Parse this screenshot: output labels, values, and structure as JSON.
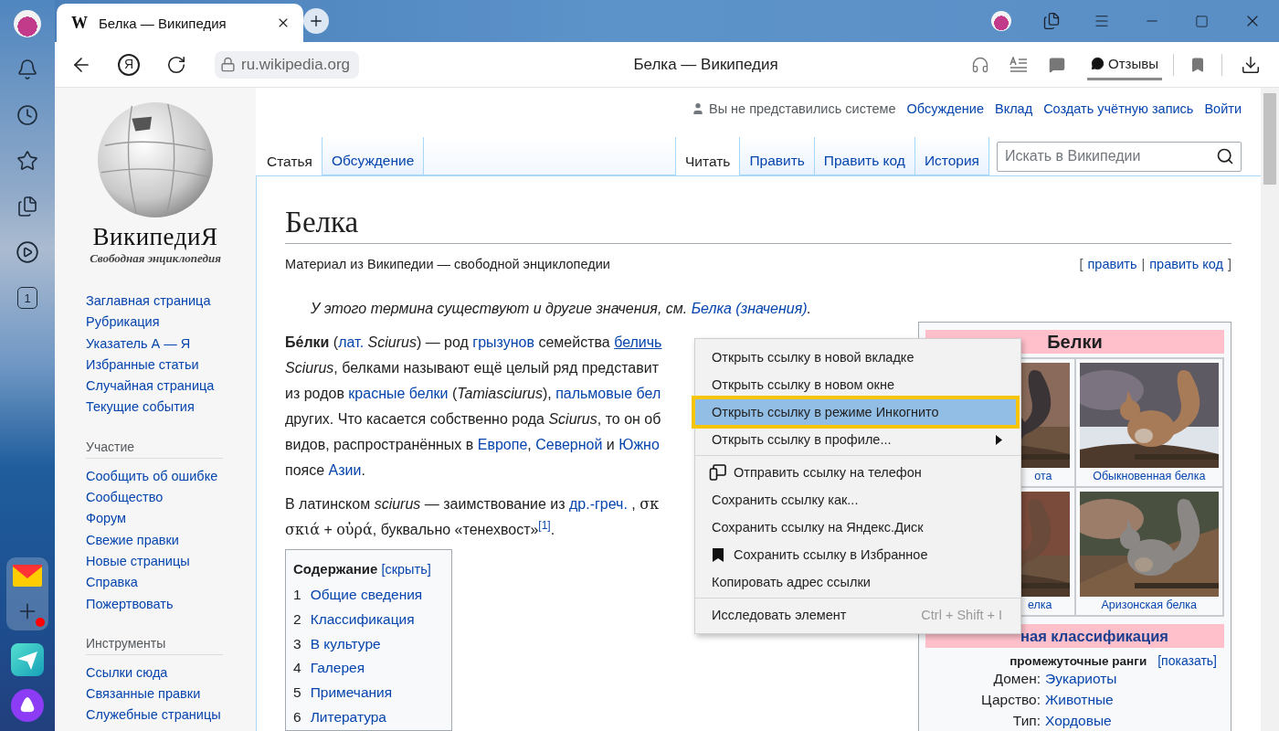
{
  "browser": {
    "tabs": [
      {
        "favicon": "W",
        "title": "Белка — Википедия",
        "selected": true
      }
    ],
    "toolbar": {
      "home_button": "Я",
      "address": "ru.wikipedia.org",
      "page_title": "Белка — Википедия",
      "reviews": "Отзывы"
    },
    "side_rail": {
      "tab_counter": "1"
    }
  },
  "wiki": {
    "logo": {
      "wordmark": "ВикипедиЯ",
      "tagline": "Свободная энциклопедия"
    },
    "nav_groups": [
      {
        "items": [
          "Заглавная страница",
          "Рубрикация",
          "Указатель А — Я",
          "Избранные статьи",
          "Случайная страница",
          "Текущие события"
        ]
      },
      {
        "heading": "Участие",
        "items": [
          "Сообщить об ошибке",
          "Сообщество",
          "Форум",
          "Свежие правки",
          "Новые страницы",
          "Справка",
          "Пожертвовать"
        ]
      },
      {
        "heading": "Инструменты",
        "items": [
          "Ссылки сюда",
          "Связанные правки",
          "Служебные страницы"
        ]
      }
    ],
    "personal": {
      "user": "Вы не представились системе",
      "links": [
        "Обсуждение",
        "Вклад",
        "Создать учётную запись",
        "Войти"
      ]
    },
    "left_tabs": [
      {
        "label": "Статья",
        "selected": true
      },
      {
        "label": "Обсуждение",
        "selected": false
      }
    ],
    "right_tabs": [
      {
        "label": "Читать",
        "selected": true
      },
      {
        "label": "Править",
        "selected": false
      },
      {
        "label": "Править код",
        "selected": false
      },
      {
        "label": "История",
        "selected": false
      }
    ],
    "search": {
      "placeholder": "Искать в Википедии"
    }
  },
  "article": {
    "title": "Белка",
    "subtitle": "Материал из Википедии — свободной энциклопедии",
    "edit_links": {
      "open": "[",
      "separator": "|",
      "close": "]",
      "links": [
        "править",
        "править код"
      ]
    },
    "hatnote": [
      {
        "text": "У этого термина существуют и другие значения, см. "
      },
      {
        "text": "Белка (значения)",
        "link": true
      },
      {
        "text": "."
      }
    ],
    "paragraphs": [
      {
        "lines": [
          [
            {
              "text": "**Бе́лки** ("
            },
            {
              "text": "лат.",
              "link": true
            },
            {
              "text": " *Sciurus*) — род "
            },
            {
              "text": "грызунов",
              "link": true
            },
            {
              "text": " семейства "
            },
            {
              "text": "беличь",
              "link": true,
              "hovered": true
            }
          ],
          [
            {
              "text": "*Sciurus*, белками называют ещё целый ряд представит"
            }
          ],
          [
            {
              "text": "из родов "
            },
            {
              "text": "красные белки",
              "link": true
            },
            {
              "text": " (*Tamiasciurus*), "
            },
            {
              "text": "пальмовые бел",
              "link": true
            }
          ],
          [
            {
              "text": "других. Что касается собственно рода *Sciurus*, то он об"
            }
          ],
          [
            {
              "text": "видов, распространённых в "
            },
            {
              "text": "Европе",
              "link": true
            },
            {
              "text": ", "
            },
            {
              "text": "Северной",
              "link": true
            },
            {
              "text": " и "
            },
            {
              "text": "Южно",
              "link": true
            }
          ],
          [
            {
              "text": "поясе "
            },
            {
              "text": "Азии",
              "link": true
            },
            {
              "text": "."
            }
          ]
        ]
      },
      {
        "lines": [
          [
            {
              "text": "В латинском *sciurus* — заимствование из "
            },
            {
              "text": "др.-греч.",
              "link": true
            },
            {
              "text": " , "
            },
            {
              "text": "σκ",
              "serif": true
            }
          ],
          [
            {
              "text": "σκιά",
              "serif": true
            },
            {
              "text": " + "
            },
            {
              "text": "οὐρά",
              "serif": true
            },
            {
              "text": ", буквально «тенехвост»"
            },
            {
              "text": "[1]",
              "link": true,
              "sup": true
            },
            {
              "text": "."
            }
          ]
        ]
      }
    ],
    "toc": {
      "title": "Содержание",
      "toggle": "[скрыть]",
      "items": [
        {
          "number": "1",
          "text": "Общие сведения"
        },
        {
          "number": "2",
          "text": "Классификация"
        },
        {
          "number": "3",
          "text": "В культуре"
        },
        {
          "number": "4",
          "text": "Галерея"
        },
        {
          "number": "5",
          "text": "Примечания"
        },
        {
          "number": "6",
          "text": "Литература"
        }
      ]
    },
    "infobox": {
      "title": "Белки",
      "images": [
        {
          "caption": "ота"
        },
        {
          "caption": "Обыкновенная белка"
        },
        {
          "caption": "елка"
        },
        {
          "caption": "Аризонская белка"
        }
      ],
      "section": "ная классификация",
      "ranks_label": "промежуточные ранги",
      "ranks_toggle": "[показать]",
      "rows": [
        {
          "label": "Домен:",
          "value": "Эукариоты"
        },
        {
          "label": "Царство:",
          "value": "Животные"
        },
        {
          "label": "Тип:",
          "value": "Хордовые"
        }
      ]
    }
  },
  "context_menu": {
    "groups": [
      [
        {
          "label": "Открыть ссылку в новой вкладке",
          "kind": "plain",
          "selected": false
        },
        {
          "label": "Открыть ссылку в новом окне",
          "kind": "plain",
          "selected": false
        },
        {
          "label": "Открыть ссылку в режиме Инкогнито",
          "kind": "plain",
          "selected": true
        },
        {
          "label": "Открыть ссылку в профиле...",
          "kind": "submenu",
          "selected": false
        }
      ],
      [
        {
          "label": "Отправить ссылку на телефон",
          "kind": "phone",
          "selected": false
        },
        {
          "label": "Сохранить ссылку как...",
          "kind": "plain",
          "selected": false
        },
        {
          "label": "Сохранить ссылку на Яндекс.Диск",
          "kind": "plain",
          "selected": false
        },
        {
          "label": "Сохранить ссылку в Избранное",
          "kind": "bookmark",
          "selected": false
        },
        {
          "label": "Копировать адрес ссылки",
          "kind": "plain",
          "selected": false
        }
      ],
      [
        {
          "label": "Исследовать элемент",
          "kind": "shortcut",
          "shortcut": "Ctrl + Shift + I",
          "selected": false
        }
      ]
    ]
  }
}
